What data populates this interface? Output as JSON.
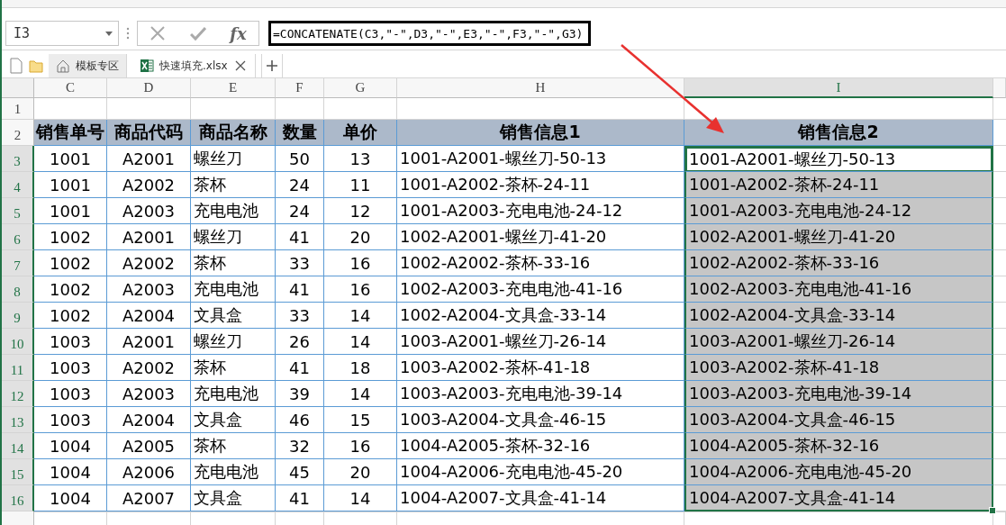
{
  "name_box": {
    "value": "I3"
  },
  "formula_bar": {
    "fx": "fx",
    "formula": "=CONCATENATE(C3,\"-\",D3,\"-\",E3,\"-\",F3,\"-\",G3)"
  },
  "file_tabs": [
    {
      "label": "模板专区",
      "kind": "home",
      "selected": false
    },
    {
      "label": "快速填充.xlsx",
      "kind": "workbook",
      "selected": true
    }
  ],
  "columns": [
    {
      "label": "C",
      "selected": false
    },
    {
      "label": "D",
      "selected": false
    },
    {
      "label": "E",
      "selected": false
    },
    {
      "label": "F",
      "selected": false
    },
    {
      "label": "G",
      "selected": false
    },
    {
      "label": "H",
      "selected": false
    },
    {
      "label": "I",
      "selected": true
    }
  ],
  "rows": [
    {
      "number": "1",
      "kind": "blank",
      "selected": false,
      "active": false
    },
    {
      "number": "2",
      "kind": "header",
      "selected": false,
      "active": false,
      "cells": [
        "销售单号",
        "商品代码",
        "商品名称",
        "数量",
        "单价",
        "销售信息1",
        "销售信息2"
      ]
    },
    {
      "number": "3",
      "kind": "data",
      "selected": true,
      "active": true,
      "cells": [
        "1001",
        "A2001",
        "螺丝刀",
        "50",
        "13",
        "1001-A2001-螺丝刀-50-13",
        "1001-A2001-螺丝刀-50-13"
      ]
    },
    {
      "number": "4",
      "kind": "data",
      "selected": true,
      "active": false,
      "cells": [
        "1001",
        "A2002",
        "茶杯",
        "24",
        "11",
        "1001-A2002-茶杯-24-11",
        "1001-A2002-茶杯-24-11"
      ]
    },
    {
      "number": "5",
      "kind": "data",
      "selected": true,
      "active": false,
      "cells": [
        "1001",
        "A2003",
        "充电电池",
        "24",
        "12",
        "1001-A2003-充电电池-24-12",
        "1001-A2003-充电电池-24-12"
      ]
    },
    {
      "number": "6",
      "kind": "data",
      "selected": true,
      "active": false,
      "cells": [
        "1002",
        "A2001",
        "螺丝刀",
        "41",
        "20",
        "1002-A2001-螺丝刀-41-20",
        "1002-A2001-螺丝刀-41-20"
      ]
    },
    {
      "number": "7",
      "kind": "data",
      "selected": true,
      "active": false,
      "cells": [
        "1002",
        "A2002",
        "茶杯",
        "33",
        "16",
        "1002-A2002-茶杯-33-16",
        "1002-A2002-茶杯-33-16"
      ]
    },
    {
      "number": "8",
      "kind": "data",
      "selected": true,
      "active": false,
      "cells": [
        "1002",
        "A2003",
        "充电电池",
        "41",
        "16",
        "1002-A2003-充电电池-41-16",
        "1002-A2003-充电电池-41-16"
      ]
    },
    {
      "number": "9",
      "kind": "data",
      "selected": true,
      "active": false,
      "cells": [
        "1002",
        "A2004",
        "文具盒",
        "33",
        "14",
        "1002-A2004-文具盒-33-14",
        "1002-A2004-文具盒-33-14"
      ]
    },
    {
      "number": "10",
      "kind": "data",
      "selected": true,
      "active": false,
      "cells": [
        "1003",
        "A2001",
        "螺丝刀",
        "26",
        "14",
        "1003-A2001-螺丝刀-26-14",
        "1003-A2001-螺丝刀-26-14"
      ]
    },
    {
      "number": "11",
      "kind": "data",
      "selected": true,
      "active": false,
      "cells": [
        "1003",
        "A2002",
        "茶杯",
        "41",
        "18",
        "1003-A2002-茶杯-41-18",
        "1003-A2002-茶杯-41-18"
      ]
    },
    {
      "number": "12",
      "kind": "data",
      "selected": true,
      "active": false,
      "cells": [
        "1003",
        "A2003",
        "充电电池",
        "39",
        "14",
        "1003-A2003-充电电池-39-14",
        "1003-A2003-充电电池-39-14"
      ]
    },
    {
      "number": "13",
      "kind": "data",
      "selected": true,
      "active": false,
      "cells": [
        "1003",
        "A2004",
        "文具盒",
        "46",
        "15",
        "1003-A2004-文具盒-46-15",
        "1003-A2004-文具盒-46-15"
      ]
    },
    {
      "number": "14",
      "kind": "data",
      "selected": true,
      "active": false,
      "cells": [
        "1004",
        "A2005",
        "茶杯",
        "32",
        "16",
        "1004-A2005-茶杯-32-16",
        "1004-A2005-茶杯-32-16"
      ]
    },
    {
      "number": "15",
      "kind": "data",
      "selected": true,
      "active": false,
      "cells": [
        "1004",
        "A2006",
        "充电电池",
        "45",
        "20",
        "1004-A2006-充电电池-45-20",
        "1004-A2006-充电电池-45-20"
      ]
    },
    {
      "number": "16",
      "kind": "data",
      "selected": true,
      "active": false,
      "cells": [
        "1004",
        "A2007",
        "文具盒",
        "41",
        "14",
        "1004-A2007-文具盒-41-14",
        "1004-A2007-文具盒-41-14"
      ]
    }
  ]
}
